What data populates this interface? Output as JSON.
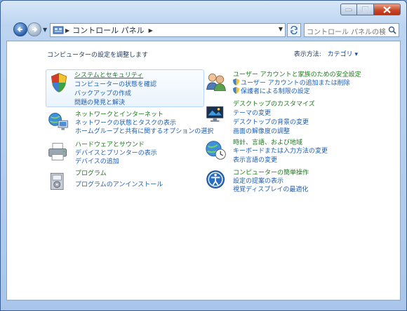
{
  "window": {
    "accent": "#3b5f94",
    "link_color": "#1f5fb0",
    "title_color": "#1c7a1c"
  },
  "address": {
    "root_icon": "control-panel-icon",
    "path": "コントロール パネル"
  },
  "search": {
    "placeholder": "コントロール パネルの検索"
  },
  "heading": "コンピューターの設定を調整します",
  "view_by": {
    "label": "表示方法:",
    "value": "カテゴリ ▾"
  },
  "categories": [
    {
      "title": "システムとセキュリティ",
      "icon": "shield-icon",
      "links": [
        "コンピューターの状態を確認",
        "バックアップの作成",
        "問題の発見と解決"
      ]
    },
    {
      "title": "ネットワークとインターネット",
      "icon": "network-icon",
      "links": [
        "ネットワークの状態とタスクの表示",
        "ホームグループと共有に関するオプションの選択"
      ]
    },
    {
      "title": "ハードウェアとサウンド",
      "icon": "printer-icon",
      "links": [
        "デバイスとプリンターの表示",
        "デバイスの追加"
      ]
    },
    {
      "title": "プログラム",
      "icon": "programs-icon",
      "links": [
        "プログラムのアンインストール"
      ]
    },
    {
      "title": "ユーザー アカウントと家族のための安全設定",
      "icon": "users-icon",
      "links": [
        "ユーザー アカウントの追加または削除",
        "保護者による制限の設定"
      ]
    },
    {
      "title": "デスクトップのカスタマイズ",
      "icon": "desktop-icon",
      "links": [
        "テーマの変更",
        "デスクトップの背景の変更",
        "画面の解像度の調整"
      ]
    },
    {
      "title": "時計、言語、および地域",
      "icon": "globe-clock-icon",
      "links": [
        "キーボードまたは入力方法の変更",
        "表示言語の変更"
      ]
    },
    {
      "title": "コンピューターの簡単操作",
      "icon": "accessibility-icon",
      "links": [
        "設定の提案の表示",
        "視覚ディスプレイの最適化"
      ]
    }
  ]
}
